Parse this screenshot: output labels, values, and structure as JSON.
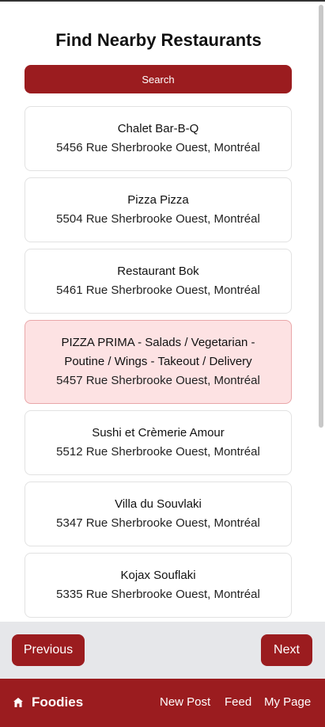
{
  "page": {
    "title": "Find Nearby Restaurants",
    "search_label": "Search"
  },
  "restaurants": [
    {
      "name": "Chalet Bar-B-Q",
      "address": "5456 Rue Sherbrooke Ouest, Montréal",
      "selected": false
    },
    {
      "name": "Pizza Pizza",
      "address": "5504 Rue Sherbrooke Ouest, Montréal",
      "selected": false
    },
    {
      "name": "Restaurant Bok",
      "address": "5461 Rue Sherbrooke Ouest, Montréal",
      "selected": false
    },
    {
      "name": "PIZZA PRIMA - Salads / Vegetarian - Poutine / Wings - Takeout / Delivery",
      "address": "5457 Rue Sherbrooke Ouest, Montréal",
      "selected": true
    },
    {
      "name": "Sushi et Crèmerie Amour",
      "address": "5512 Rue Sherbrooke Ouest, Montréal",
      "selected": false
    },
    {
      "name": "Villa du Souvlaki",
      "address": "5347 Rue Sherbrooke Ouest, Montréal",
      "selected": false
    },
    {
      "name": "Kojax Souflaki",
      "address": "5335 Rue Sherbrooke Ouest, Montréal",
      "selected": false
    }
  ],
  "pagination": {
    "previous_label": "Previous",
    "next_label": "Next"
  },
  "navbar": {
    "brand": "Foodies",
    "brand_icon": "home-icon",
    "links": [
      "New Post",
      "Feed",
      "My Page"
    ]
  },
  "colors": {
    "accent": "#9b1c1f",
    "selected_bg": "#fde2e3",
    "pager_bg": "#e6e7ea"
  }
}
